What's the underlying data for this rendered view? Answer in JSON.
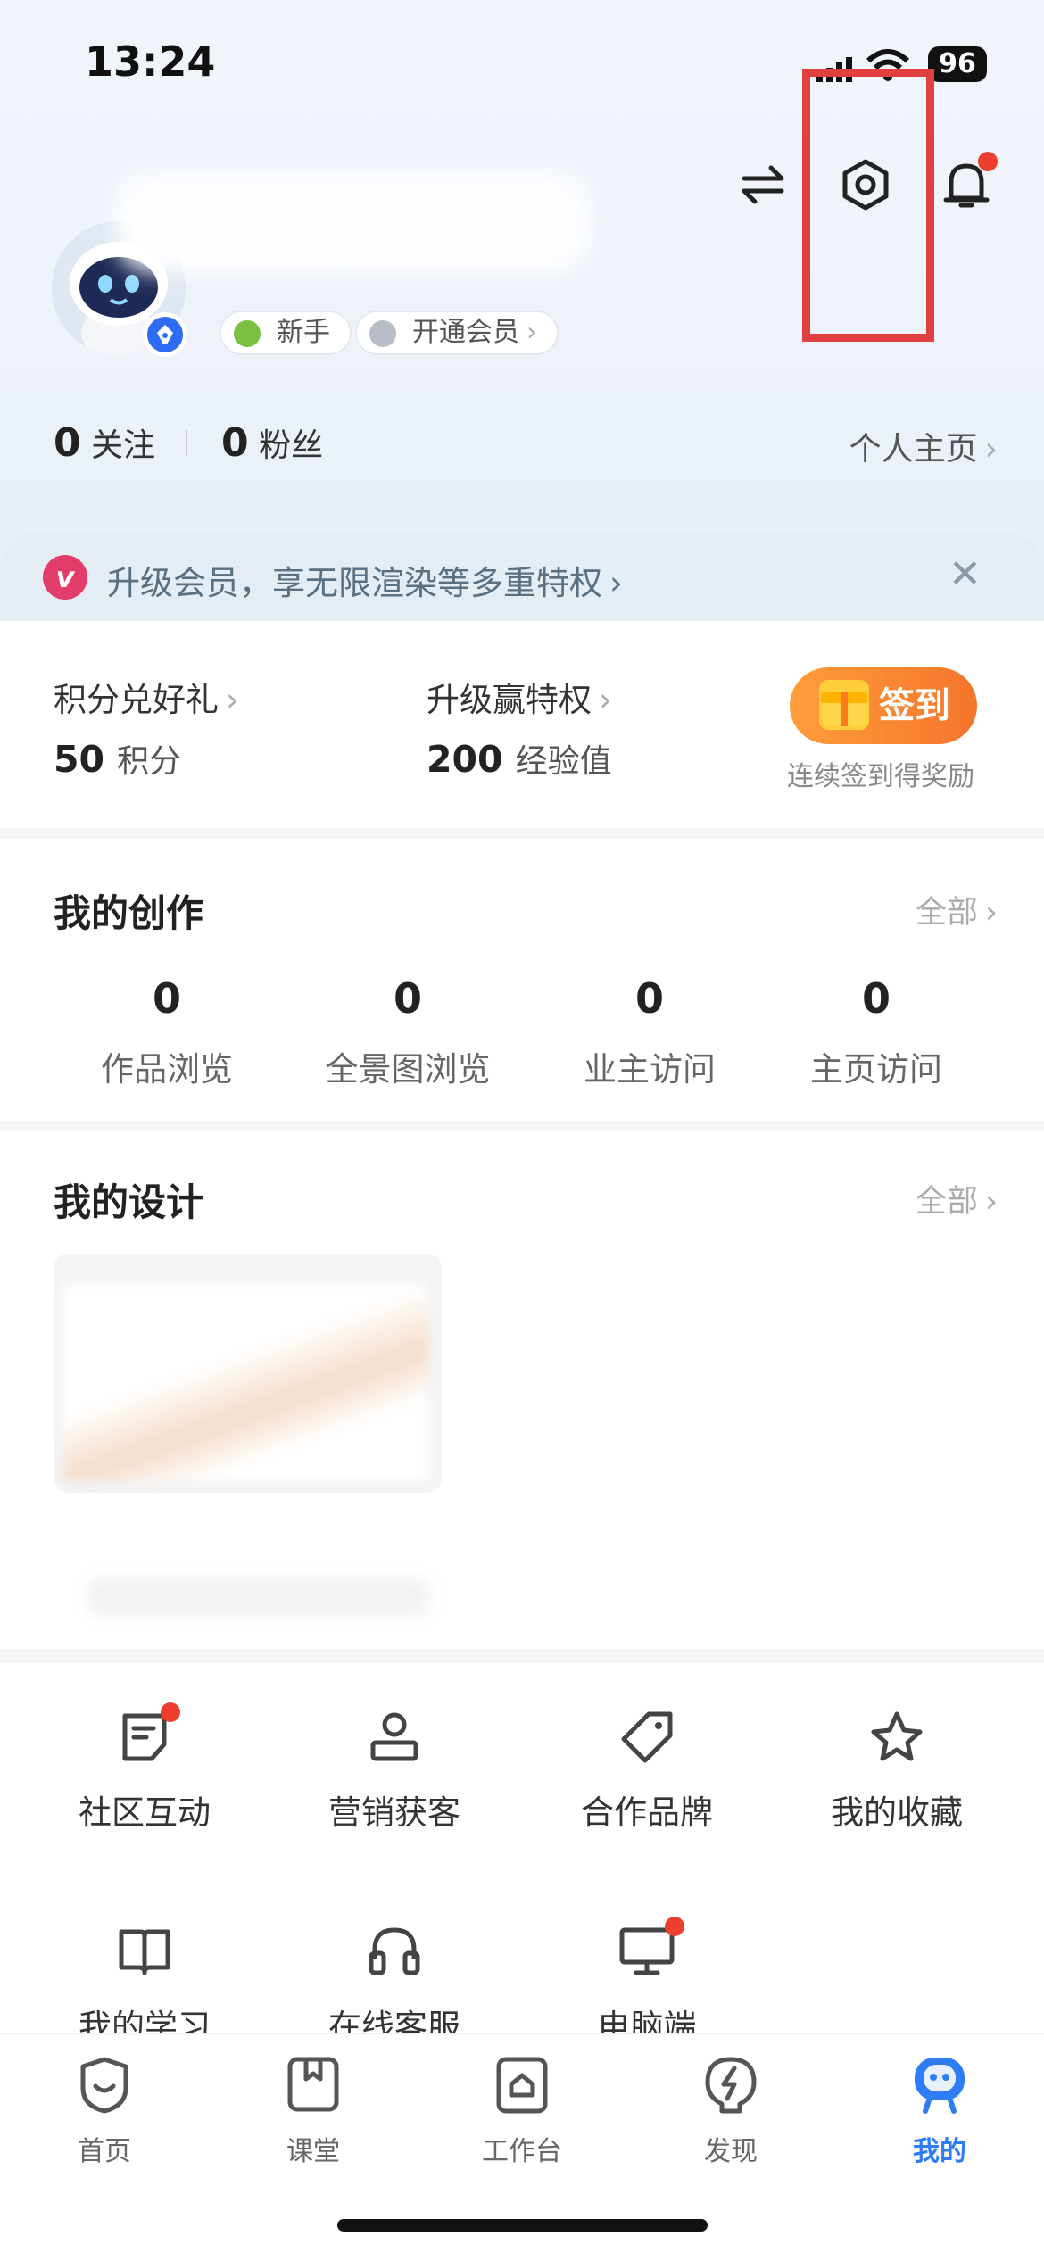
{
  "status_bar": {
    "time": "13:24",
    "battery": "96"
  },
  "header": {
    "badges": [
      {
        "label": "新手",
        "color": "#7bc043"
      },
      {
        "label": "开通会员",
        "color": "#b8bec8"
      }
    ],
    "follow_count": "0",
    "follow_label": "关注",
    "fans_count": "0",
    "fans_label": "粉丝",
    "homepage_link": "个人主页"
  },
  "promo": {
    "text": "升级会员，享无限渲染等多重特权",
    "icon_letter": "v"
  },
  "rewards": {
    "points_title": "积分兑好礼",
    "points_value": "50",
    "points_unit": "积分",
    "vip_title": "升级赢特权",
    "exp_value": "200",
    "exp_unit": "经验值",
    "sign_label": "签到",
    "sign_sub": "连续签到得奖励"
  },
  "creations": {
    "title": "我的创作",
    "more": "全部",
    "stats": [
      {
        "value": "0",
        "label": "作品浏览"
      },
      {
        "value": "0",
        "label": "全景图浏览"
      },
      {
        "value": "0",
        "label": "业主访问"
      },
      {
        "value": "0",
        "label": "主页访问"
      }
    ]
  },
  "designs": {
    "title": "我的设计",
    "more": "全部"
  },
  "services": [
    {
      "label": "社区互动",
      "icon": "note-icon"
    },
    {
      "label": "营销获客",
      "icon": "user-icon"
    },
    {
      "label": "合作品牌",
      "icon": "tag-icon"
    },
    {
      "label": "我的收藏",
      "icon": "star-icon"
    },
    {
      "label": "我的学习",
      "icon": "book-icon"
    },
    {
      "label": "在线客服",
      "icon": "headset-icon"
    },
    {
      "label": "电脑端",
      "icon": "monitor-icon"
    }
  ],
  "tabbar": [
    {
      "label": "首页",
      "icon": "home-icon"
    },
    {
      "label": "课堂",
      "icon": "bookmark-icon"
    },
    {
      "label": "工作台",
      "icon": "workbench-icon"
    },
    {
      "label": "发现",
      "icon": "discover-icon"
    },
    {
      "label": "我的",
      "icon": "profile-icon"
    }
  ],
  "colors": {
    "accent": "#2e7cf6",
    "sign_button": "#f4752b",
    "highlight_box": "#e04040",
    "badge_dot": "#ee3e2e"
  }
}
